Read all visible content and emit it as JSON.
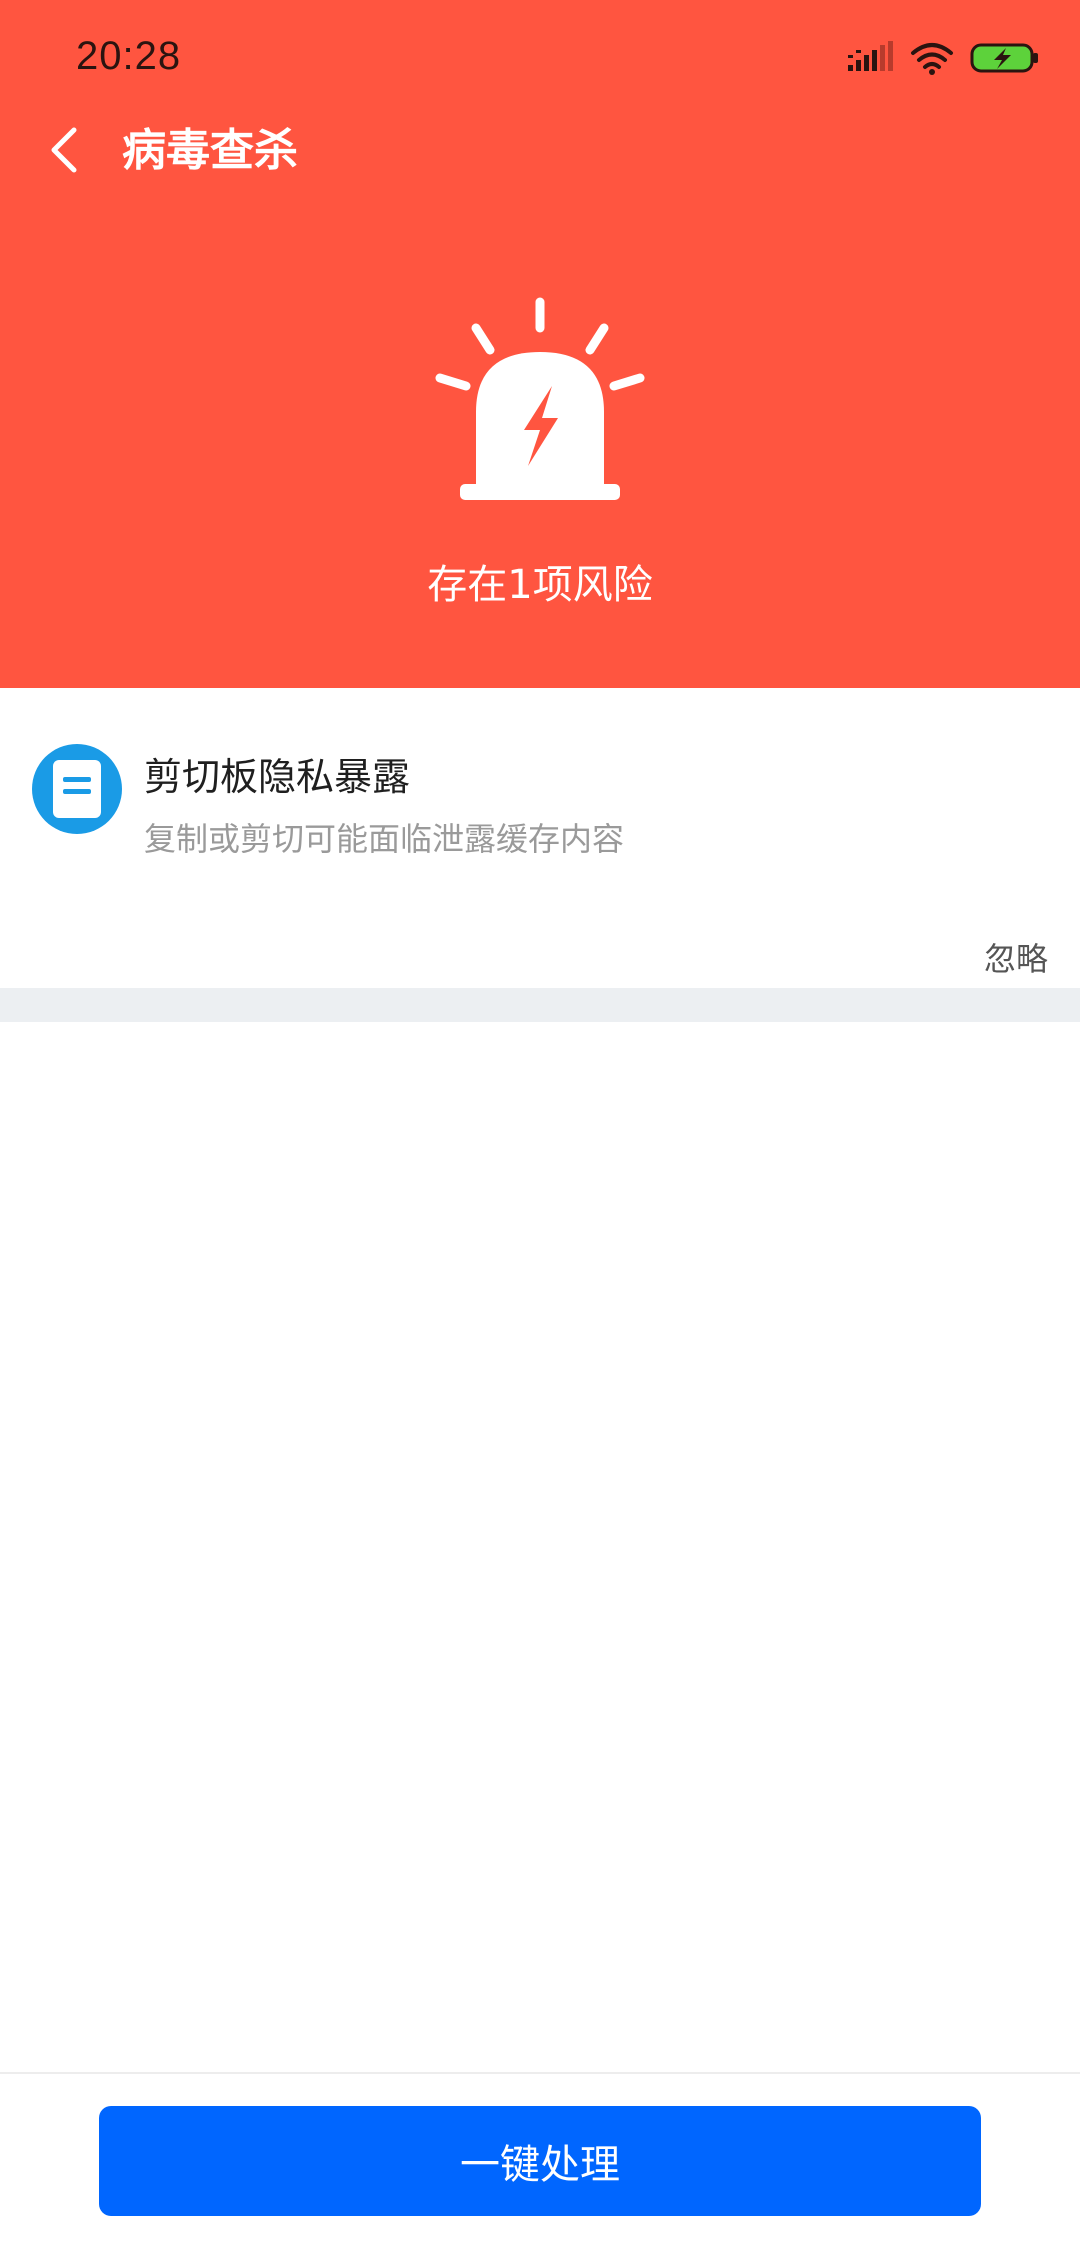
{
  "status_bar": {
    "time": "20:28",
    "icons": [
      "signal-icon",
      "wifi-icon",
      "battery-charging-icon"
    ]
  },
  "nav": {
    "title": "病毒查杀",
    "back_icon": "chevron-left-icon"
  },
  "header": {
    "icon": "alarm-light-icon",
    "risk_summary": "存在1项风险",
    "background_color": "#FF5540"
  },
  "risks": [
    {
      "icon": "clipboard-icon",
      "title": "剪切板隐私暴露",
      "description": "复制或剪切可能面临泄露缓存内容",
      "ignore_label": "忽略"
    }
  ],
  "footer": {
    "action_label": "一键处理",
    "action_color": "#0066FF"
  }
}
